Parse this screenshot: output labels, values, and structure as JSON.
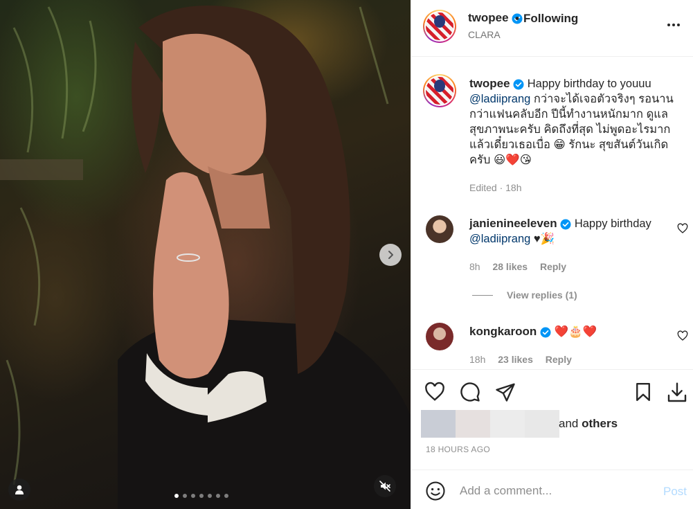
{
  "post": {
    "username": "twopee",
    "follow_status": "Following",
    "location": "CLARA"
  },
  "caption": {
    "username": "twopee",
    "text_lead": "Happy birthday to youuu",
    "mention": "@ladiiprang",
    "text_body": "กว่าจะได้เจอตัวจริงๆ รอนานกว่าแฟนคลับอีก ปีนี้ทำงานหนักมาก ดูแลสุขภาพนะครับ คิดถึงที่สุด ไม่พูดอะไรมากแล้วเดี๋ยวเธอเบื่อ",
    "text_after_emoji": "รักนะ สุขสันต์วันเกิดครับ",
    "emoji_grin": "😁",
    "emoji_end": "😃❤️😘",
    "edited": "Edited · 18h"
  },
  "comments": [
    {
      "username": "janienineeleven",
      "text": "Happy birthday",
      "mention": "@ladiiprang",
      "suffix": "♥🎉",
      "time": "8h",
      "likes": "28 likes",
      "reply": "Reply",
      "view_replies": "View replies (1)"
    },
    {
      "username": "kongkaroon",
      "text": "❤️🎂❤️",
      "time": "18h",
      "likes": "23 likes",
      "reply": "Reply"
    }
  ],
  "likes": {
    "and": "and",
    "others": "others"
  },
  "timestamp": "18 HOURS AGO",
  "comment_box": {
    "placeholder": "Add a comment...",
    "post": "Post"
  },
  "carousel": {
    "slides": 7,
    "active": 0
  },
  "colors": {
    "link": "#00376b",
    "verified": "#0095f6",
    "muted": "#8e8e8e",
    "post_disabled": "#b3dbff"
  }
}
